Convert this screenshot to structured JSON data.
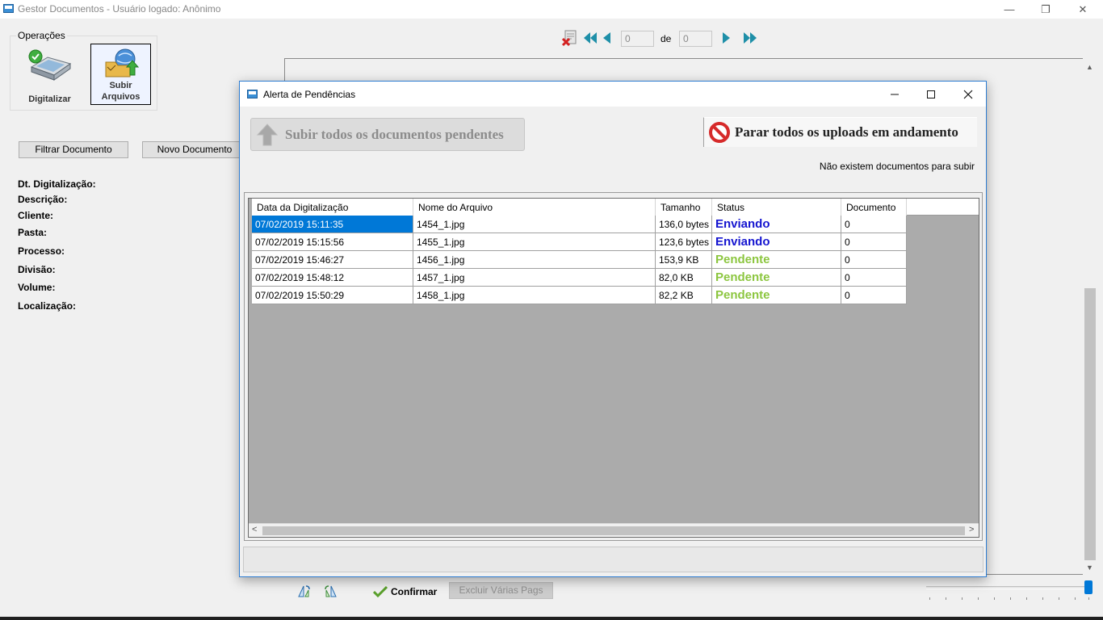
{
  "window": {
    "title": "Gestor Documentos - Usuário logado: Anônimo",
    "minimize": "—",
    "restore": "❐",
    "close": "✕"
  },
  "operations": {
    "label": "Operações",
    "digitalizar": "Digitalizar",
    "subir_line1": "Subir",
    "subir_line2": "Arquivos"
  },
  "buttons": {
    "filtrar": "Filtrar Documento",
    "novo": "Novo Documento"
  },
  "fields": [
    "Dt. Digitalização:",
    "Descrição:",
    "Cliente:",
    "Pasta:",
    "Processo:",
    "Divisão:",
    "Volume:",
    "Localização:"
  ],
  "navigation": {
    "current_page": "0",
    "de_label": "de",
    "total_pages": "0"
  },
  "bottom_toolbar": {
    "confirm": "Confirmar",
    "excluir": "Excluir Várias Pags"
  },
  "dialog": {
    "title": "Alerta de Pendências",
    "upload_all": "Subir todos os documentos pendentes",
    "stop_all": "Parar todos os uploads em andamento",
    "no_docs": "Não existem documentos para subir",
    "columns": [
      "Data da Digitalização",
      "Nome do Arquivo",
      "Tamanho",
      "Status",
      "Documento"
    ],
    "rows": [
      {
        "date": "07/02/2019 15:11:35",
        "file": "1454_1.jpg",
        "size": "136,0 bytes",
        "status": "Enviando",
        "doc": "0"
      },
      {
        "date": "07/02/2019 15:15:56",
        "file": "1455_1.jpg",
        "size": "123,6 bytes",
        "status": "Enviando",
        "doc": "0"
      },
      {
        "date": "07/02/2019 15:46:27",
        "file": "1456_1.jpg",
        "size": "153,9 KB",
        "status": "Pendente",
        "doc": "0"
      },
      {
        "date": "07/02/2019 15:48:12",
        "file": "1457_1.jpg",
        "size": "82,0 KB",
        "status": "Pendente",
        "doc": "0"
      },
      {
        "date": "07/02/2019 15:50:29",
        "file": "1458_1.jpg",
        "size": "82,2 KB",
        "status": "Pendente",
        "doc": "0"
      }
    ],
    "colors": {
      "enviando": "#1515d0",
      "pendente": "#8cc63f",
      "selection": "#0078d7"
    }
  }
}
